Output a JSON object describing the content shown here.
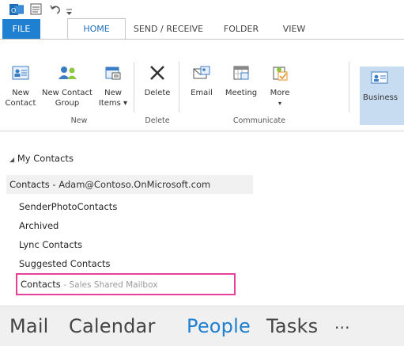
{
  "tabs": {
    "file": "FILE",
    "home": "HOME",
    "send_receive": "SEND / RECEIVE",
    "folder": "FOLDER",
    "view": "VIEW"
  },
  "ribbon": {
    "new_contact": [
      "New",
      "Contact"
    ],
    "new_contact_group": [
      "New Contact",
      "Group"
    ],
    "new_items": [
      "New",
      "Items ▾"
    ],
    "delete": "Delete",
    "email": "Email",
    "meeting": "Meeting",
    "more": "More",
    "business": "Business",
    "groups": {
      "new": "New",
      "delete": "Delete",
      "communicate": "Communicate"
    }
  },
  "folders": {
    "root": "My Contacts",
    "items": [
      {
        "name": "Contacts",
        "detail": "- Adam@Contoso.OnMicrosoft.com"
      },
      {
        "name": "SenderPhotoContacts"
      },
      {
        "name": "Archived"
      },
      {
        "name": "Lync Contacts"
      },
      {
        "name": "Suggested Contacts"
      },
      {
        "name": "Contacts",
        "detail": "- Sales Shared Mailbox"
      }
    ]
  },
  "nav": {
    "mail": "Mail",
    "calendar": "Calendar",
    "people": "People",
    "tasks": "Tasks",
    "more": "···"
  },
  "colors": {
    "file_tab": "#1f7fd0",
    "active_nav": "#1f7fd0",
    "highlight": "#e6409a"
  }
}
